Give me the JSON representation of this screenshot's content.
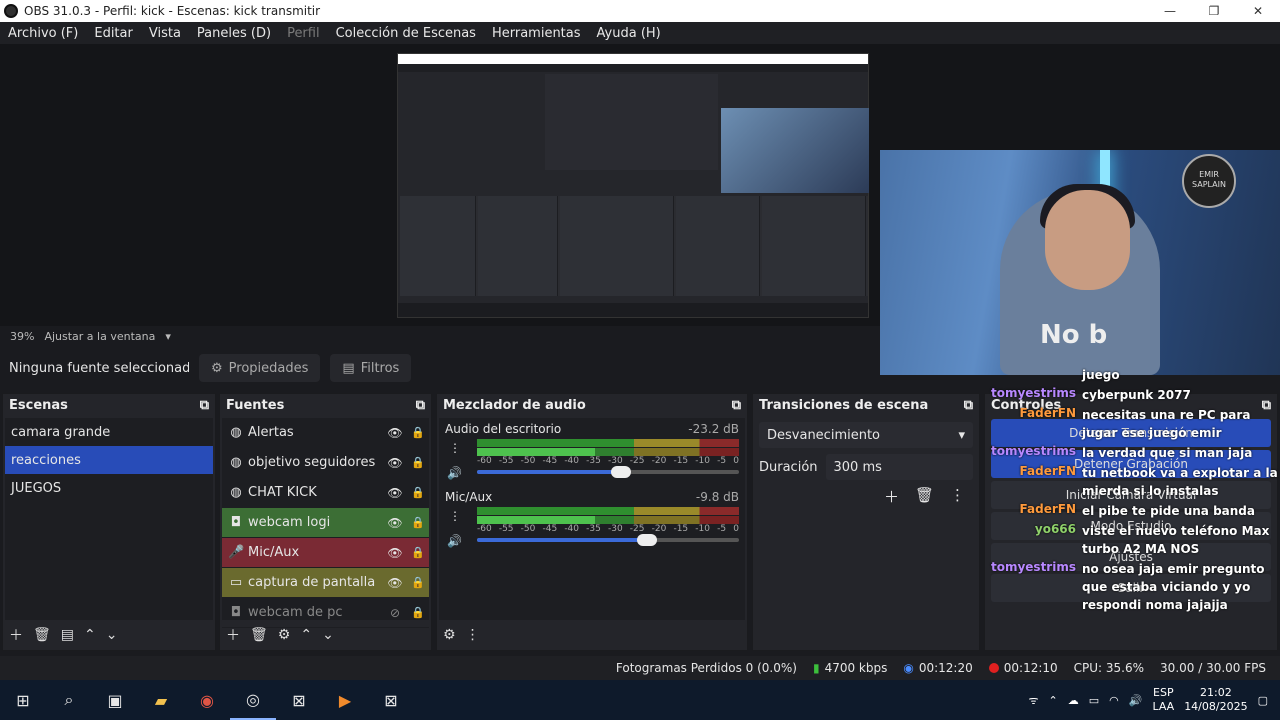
{
  "window": {
    "title": "OBS 31.0.3 - Perfil: kick - Escenas: kick transmitir",
    "minimize": "—",
    "restore": "❐",
    "close": "✕"
  },
  "menu": [
    "Archivo (F)",
    "Editar",
    "Vista",
    "Paneles (D)",
    "Perfil",
    "Colección de Escenas",
    "Herramientas",
    "Ayuda (H)"
  ],
  "zoom": {
    "value": "39%",
    "fit": "Ajustar a la ventana"
  },
  "context": {
    "no_source": "Ninguna fuente seleccionada",
    "properties": "Propiedades",
    "filters": "Filtros"
  },
  "webcam": {
    "logo": "EMIR SAPLAIN",
    "shirt": "No b"
  },
  "scenes": {
    "title": "Escenas",
    "items": [
      "camara grande",
      "reacciones",
      "JUEGOS"
    ],
    "selected": 1
  },
  "sources": {
    "title": "Fuentes",
    "items": [
      {
        "name": "Alertas",
        "icon": "globe-icon"
      },
      {
        "name": "objetivo seguidores",
        "icon": "globe-icon"
      },
      {
        "name": "CHAT KICK",
        "icon": "globe-icon"
      },
      {
        "name": "webcam logi",
        "icon": "camera-icon",
        "color": "#3c6e35"
      },
      {
        "name": "Mic/Aux",
        "icon": "mic-icon",
        "color": "#7a2a34"
      },
      {
        "name": "captura de pantalla",
        "icon": "monitor-icon",
        "color": "#6a6a2e"
      },
      {
        "name": "webcam de pc",
        "icon": "camera-icon",
        "hidden": true
      }
    ]
  },
  "mixer": {
    "title": "Mezclador de audio",
    "channels": [
      {
        "name": "Audio del escritorio",
        "db": "-23.2 dB",
        "volume": 0.55
      },
      {
        "name": "Mic/Aux",
        "db": "-9.8 dB",
        "volume": 0.65
      }
    ],
    "ticks": [
      "-60",
      "-55",
      "-50",
      "-45",
      "-40",
      "-35",
      "-30",
      "-25",
      "-20",
      "-15",
      "-10",
      "-5",
      "0"
    ]
  },
  "transitions": {
    "title": "Transiciones de escena",
    "selected": "Desvanecimiento",
    "duration_label": "Duración",
    "duration": "300 ms"
  },
  "controls": {
    "title": "Controles",
    "buttons": [
      "Detener Transmisión",
      "Detener Grabación",
      "Iniciar Cámara Virtual",
      "Modo Estudio",
      "Ajustes",
      "Salir"
    ]
  },
  "chat": [
    {
      "user": "",
      "msg": "juego"
    },
    {
      "user": "tomyestrims",
      "msg": "cyberpunk 2077",
      "color": "#b888ff"
    },
    {
      "user": "FaderFN",
      "msg": "necesitas una re PC para jugar ese juego emir",
      "color": "#ff9a3c"
    },
    {
      "user": "tomyestrims",
      "msg": "la verdad que si man jaja",
      "color": "#b888ff"
    },
    {
      "user": "FaderFN",
      "msg": "tu netbook va a explotar a la mierda si lo instalas",
      "color": "#ff9a3c"
    },
    {
      "user": "FaderFN",
      "msg": "el pibe te pide una banda",
      "color": "#ff9a3c"
    },
    {
      "user": "yo666",
      "msg": "viste el nuevo teléfono Max turbo A2 MA NOS",
      "color": "#8fd16a"
    },
    {
      "user": "tomyestrims",
      "msg": "no osea jaja emir pregunto que estaba viciando y yo respondi noma jajajja",
      "color": "#b888ff"
    }
  ],
  "status": {
    "dropped": "Fotogramas Perdidos 0 (0.0%)",
    "bitrate": "4700 kbps",
    "stream_time": "00:12:20",
    "rec_time": "00:12:10",
    "cpu": "CPU: 35.6%",
    "fps": "30.00 / 30.00 FPS"
  },
  "taskbar": {
    "lang1": "ESP",
    "lang2": "LAA",
    "time": "21:02",
    "date": "14/08/2025"
  }
}
